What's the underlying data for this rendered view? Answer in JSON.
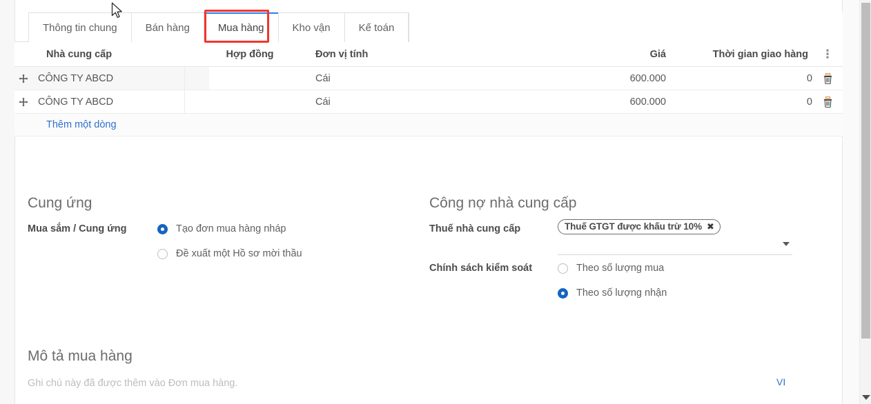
{
  "tabs": [
    {
      "label": "Thông tin chung",
      "active": false
    },
    {
      "label": "Bán hàng",
      "active": false
    },
    {
      "label": "Mua hàng",
      "active": true
    },
    {
      "label": "Kho vận",
      "active": false
    },
    {
      "label": "Kế toán",
      "active": false
    }
  ],
  "table": {
    "columns": {
      "supplier": "Nhà cung cấp",
      "contract": "Hợp đồng",
      "unit": "Đơn vị tính",
      "price": "Giá",
      "lead_time": "Thời gian giao hàng"
    },
    "rows": [
      {
        "supplier": "CÔNG TY ABCD",
        "contract": "",
        "unit": "Cái",
        "price": "600.000",
        "lead_time": "0"
      },
      {
        "supplier": "CÔNG TY ABCD",
        "contract": "",
        "unit": "Cái",
        "price": "600.000",
        "lead_time": "0"
      }
    ],
    "add_row_label": "Thêm một dòng",
    "options_icon": "kebab-menu-icon",
    "drag_icon": "drag-move-icon",
    "delete_icon": "trash-icon"
  },
  "supply": {
    "title": "Cung ứng",
    "field_label": "Mua sắm / Cung ứng",
    "options": [
      {
        "label": "Tạo đơn mua hàng nháp",
        "selected": true
      },
      {
        "label": "Đề xuất một Hồ sơ mời thầu",
        "selected": false
      }
    ]
  },
  "payable": {
    "title": "Công nợ nhà cung cấp",
    "tax_label": "Thuế nhà cung cấp",
    "tax_chip": "Thuế GTGT được khấu trừ 10%",
    "tax_chip_remove": "✖",
    "policy_label": "Chính sách kiểm soát",
    "policy_options": [
      {
        "label": "Theo số lượng mua",
        "selected": false
      },
      {
        "label": "Theo số lượng nhận",
        "selected": true
      }
    ]
  },
  "description": {
    "title": "Mô tả mua hàng",
    "placeholder": "Ghi chú này đã được thêm vào Đơn mua hàng.",
    "language_badge": "VI"
  },
  "colors": {
    "accent_blue": "#2b7de9",
    "link_blue": "#2f6fd0",
    "radio_selected": "#1565c0",
    "highlight_red": "#f0372e"
  }
}
